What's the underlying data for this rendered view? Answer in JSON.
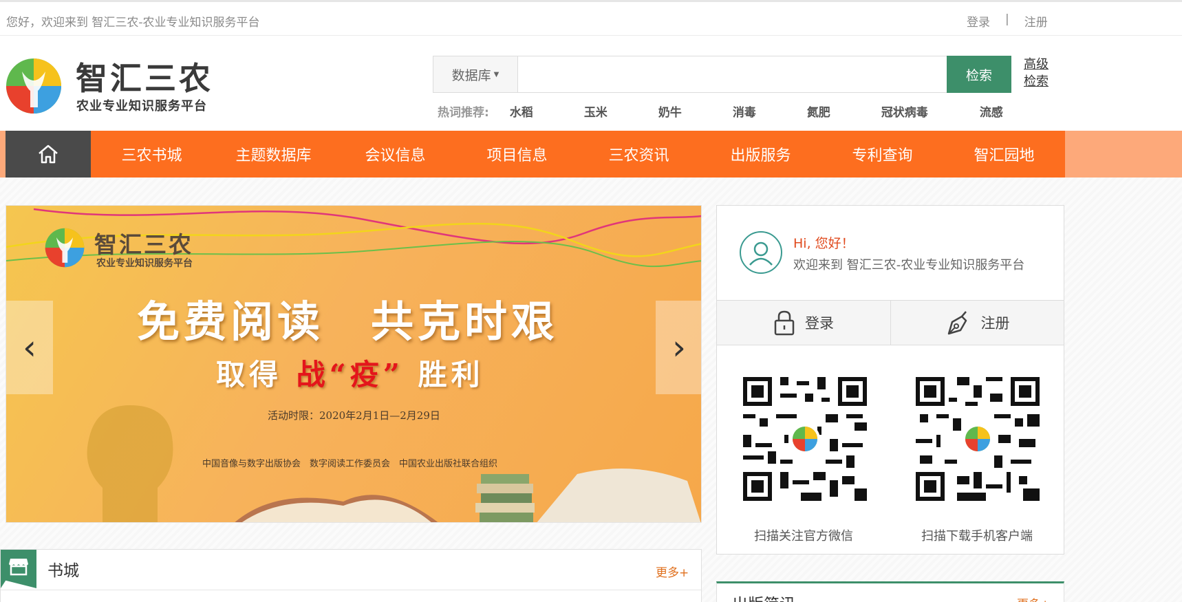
{
  "topbar": {
    "welcome": "您好，欢迎来到 智汇三农-农业专业知识服务平台",
    "login": "登录",
    "separator": "|",
    "register": "注册"
  },
  "header": {
    "logo_title": "智汇三农",
    "logo_sub": "农业专业知识服务平台",
    "search": {
      "database_label": "数据库",
      "input_value": "",
      "input_placeholder": "",
      "button_label": "检索"
    },
    "advanced_search": "高级检索",
    "hot": {
      "label": "热词推荐:",
      "words": [
        "水稻",
        "玉米",
        "奶牛",
        "消毒",
        "氮肥",
        "冠状病毒",
        "流感"
      ]
    }
  },
  "nav": {
    "home_icon": "home-icon",
    "items": [
      "三农书城",
      "主题数据库",
      "会议信息",
      "项目信息",
      "三农资讯",
      "出版服务",
      "专利查询",
      "智汇园地"
    ]
  },
  "banner": {
    "logo_title": "智汇三农",
    "logo_sub": "农业专业知识服务平台",
    "headline": "免费阅读　共克时艰",
    "sub_before": "取得",
    "sub_red": "战“疫”",
    "sub_after": "胜利",
    "date": "活动时限：2020年2月1日—2月29日",
    "orgs": "中国音像与数字出版协会　数字阅读工作委员会　中国农业出版社联合组织",
    "prev": "‹",
    "next": "›"
  },
  "user_panel": {
    "greeting": "Hi, 您好！",
    "welcome": "欢迎来到 智汇三农-农业专业知识服务平台",
    "login_label": "登录",
    "register_label": "注册",
    "qr_wechat_caption": "扫描关注官方微信",
    "qr_app_caption": "扫描下载手机客户端"
  },
  "bookstore": {
    "title": "书城",
    "more": "更多+"
  },
  "news": {
    "title": "出版简讯",
    "more": "更多+"
  },
  "colors": {
    "nav_orange": "#fd6e1f",
    "nav_home": "#4a4a4a",
    "brand_green": "#3d8f6a",
    "accent_red": "#e04b1f"
  }
}
